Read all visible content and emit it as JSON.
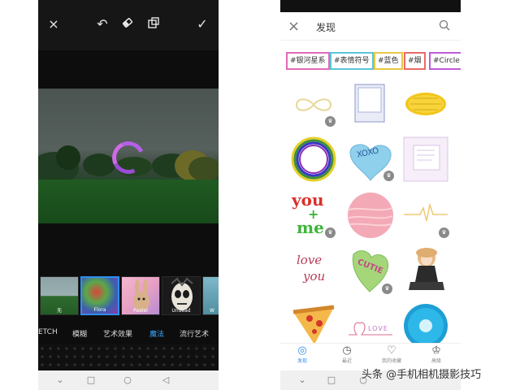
{
  "left_editor": {
    "toolbar": {
      "close_icon": "×",
      "undo_icon": "↶",
      "eraser_icon": "⌫",
      "layers_icon": "⧉",
      "check_icon": "✓"
    },
    "effect_thumbs": [
      {
        "label": "无"
      },
      {
        "label": "Flora"
      },
      {
        "label": "Pastel"
      },
      {
        "label": "Undead"
      },
      {
        "label": "W"
      }
    ],
    "categories": [
      "ETCH",
      "模糊",
      "艺术效果",
      "魔法",
      "流行艺术"
    ],
    "active_category_color": "#3aa7ff"
  },
  "right_discover": {
    "header": {
      "close_icon": "×",
      "title": "发现",
      "search_icon": "⌕"
    },
    "tags": [
      {
        "label": "#银河星系",
        "color": "#e06ab8"
      },
      {
        "label": "#表情符号",
        "color": "#5cc5d6"
      },
      {
        "label": "#蓝色",
        "color": "#e6c846"
      },
      {
        "label": "#烟",
        "color": "#e96a6a"
      },
      {
        "label": "#Circle",
        "color": "#c05ad8"
      }
    ],
    "stickers": {
      "heart_candy_1": "XOXO",
      "you_me_1": "you",
      "you_me_2": "+",
      "you_me_3": "me",
      "love_you_1": "love",
      "love_you_2": "you",
      "heart_candy_2": "CUTIE",
      "love_text": "LOVE"
    },
    "bottom_tabs": [
      {
        "label": "发现",
        "icon": "compass-icon"
      },
      {
        "label": "最近",
        "icon": "clock-icon"
      },
      {
        "label": "我的收藏",
        "icon": "heart-icon"
      },
      {
        "label": "高级",
        "icon": "crown-icon"
      }
    ],
    "accent": "#2f8ef0"
  },
  "watermark": "头条 @手机相机摄影技巧"
}
